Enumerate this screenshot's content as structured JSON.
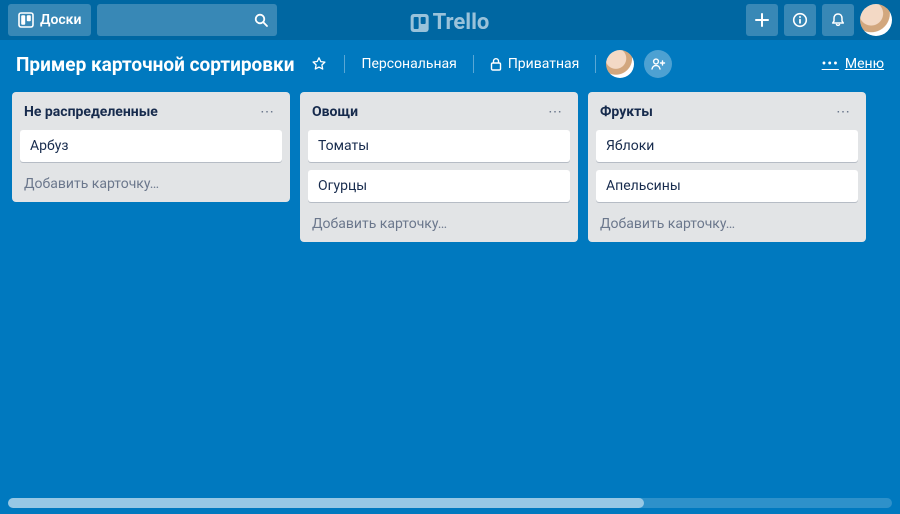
{
  "colors": {
    "board_bg": "#0079bf",
    "list_bg": "#e2e4e6",
    "card_bg": "#ffffff"
  },
  "topbar": {
    "boards_label": "Доски",
    "search_placeholder": "",
    "logo_text": "Trello"
  },
  "board_header": {
    "title": "Пример карточной сортировки",
    "team_label": "Персональная",
    "visibility_label": "Приватная",
    "menu_label": "Меню"
  },
  "add_card_label": "Добавить карточку…",
  "lists": [
    {
      "title": "Не распределенные",
      "cards": [
        "Арбуз"
      ]
    },
    {
      "title": "Овощи",
      "cards": [
        "Томаты",
        "Огурцы"
      ]
    },
    {
      "title": "Фрукты",
      "cards": [
        "Яблоки",
        "Апельсины"
      ]
    }
  ]
}
